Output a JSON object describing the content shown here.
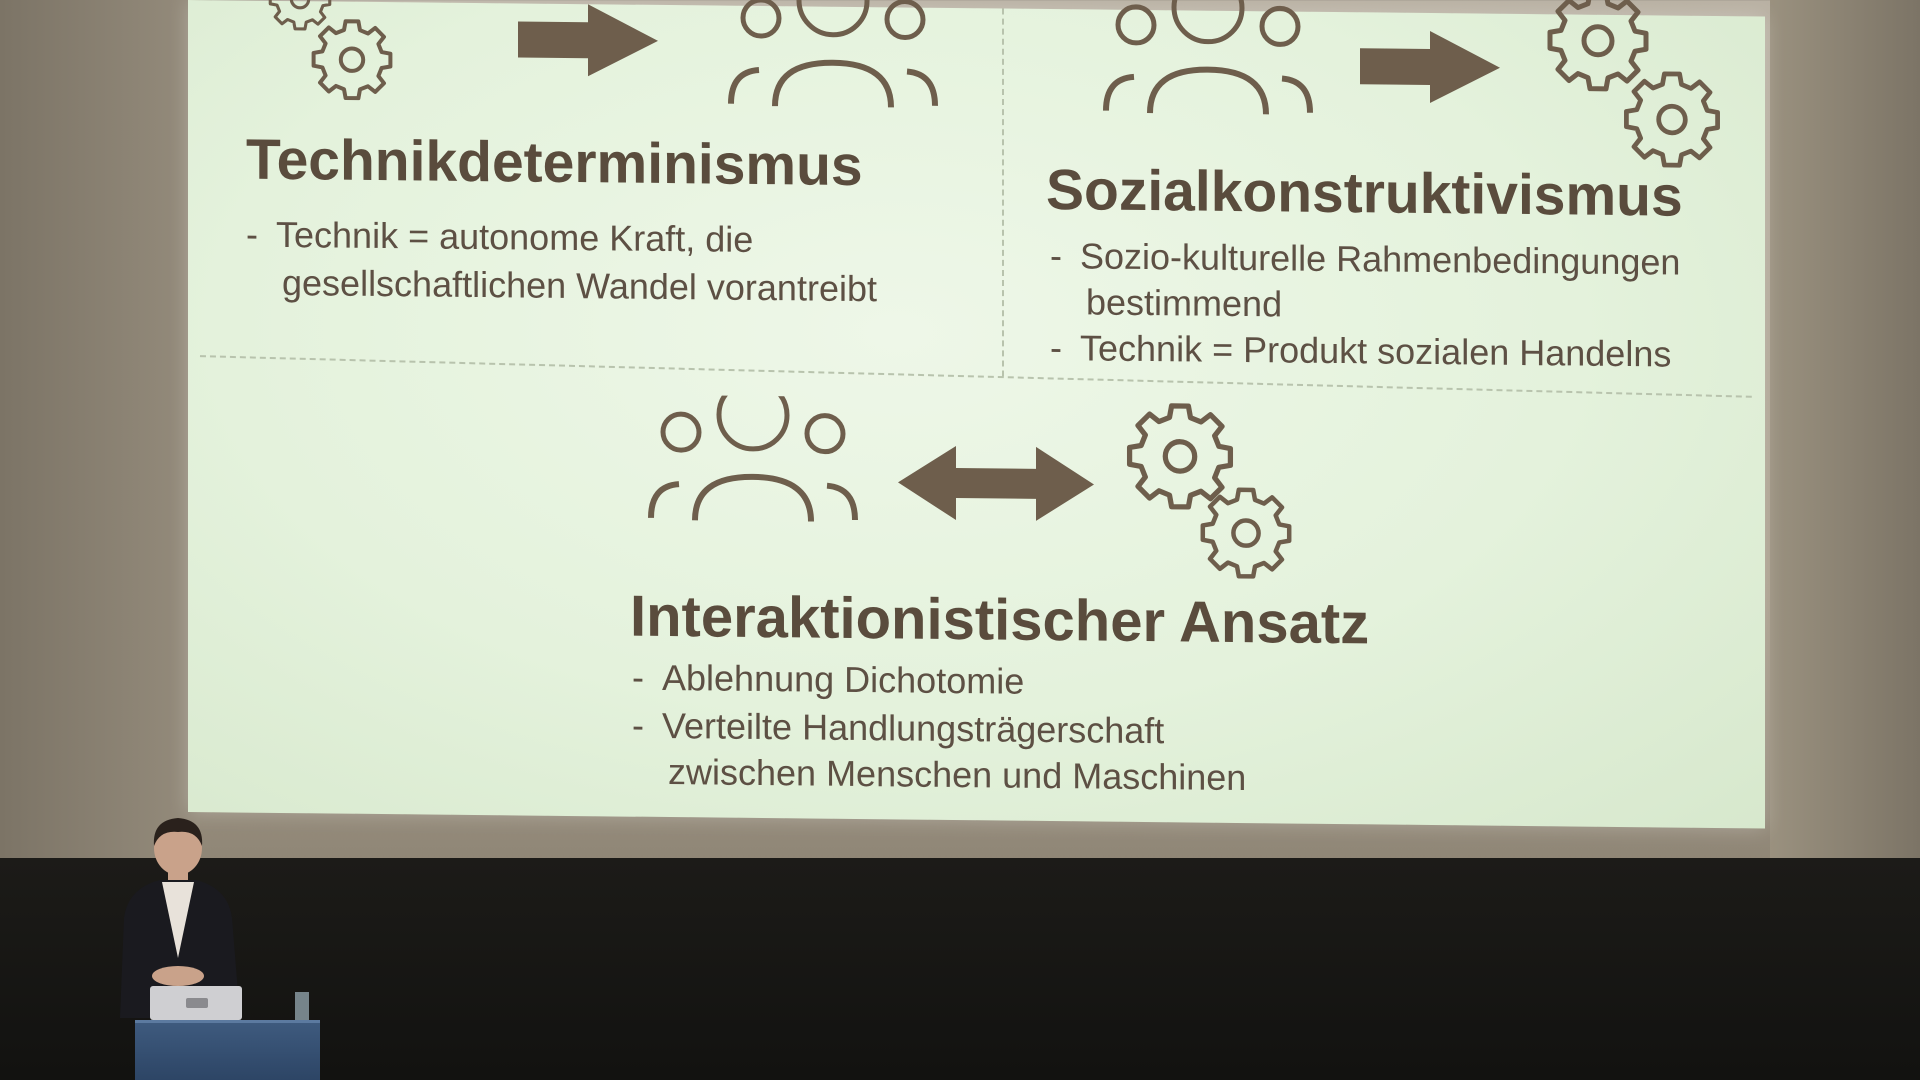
{
  "slide": {
    "top_left": {
      "heading": "Technikdeterminismus",
      "bullets": [
        {
          "dash": "-",
          "lines": [
            "Technik = autonome Kraft, die",
            "gesellschaftlichen Wandel vorantreibt"
          ]
        }
      ]
    },
    "top_right": {
      "heading": "Sozialkonstruktivismus",
      "bullets": [
        {
          "dash": "-",
          "lines": [
            "Sozio-kulturelle Rahmenbedingungen",
            "bestimmend"
          ]
        },
        {
          "dash": "-",
          "lines": [
            "Technik = Produkt sozialen Handelns"
          ]
        }
      ]
    },
    "bottom": {
      "heading": "Interaktionistischer Ansatz",
      "bullets": [
        {
          "dash": "-",
          "lines": [
            "Ablehnung Dichotomie"
          ]
        },
        {
          "dash": "-",
          "lines": [
            "Verteilte Handlungsträgerschaft",
            "zwischen Menschen und Maschinen"
          ]
        }
      ]
    },
    "icons": {
      "top_left": [
        "gears-icon",
        "arrow-right-icon",
        "people-icon"
      ],
      "top_right": [
        "people-icon",
        "arrow-right-icon",
        "gears-icon"
      ],
      "bottom": [
        "people-icon",
        "double-arrow-icon",
        "gears-icon"
      ]
    }
  },
  "colors": {
    "slide_background": "#e6f3de",
    "text": "#5a4c3d",
    "icon": "#6e5e4c",
    "podium": "#3e5a7e"
  }
}
